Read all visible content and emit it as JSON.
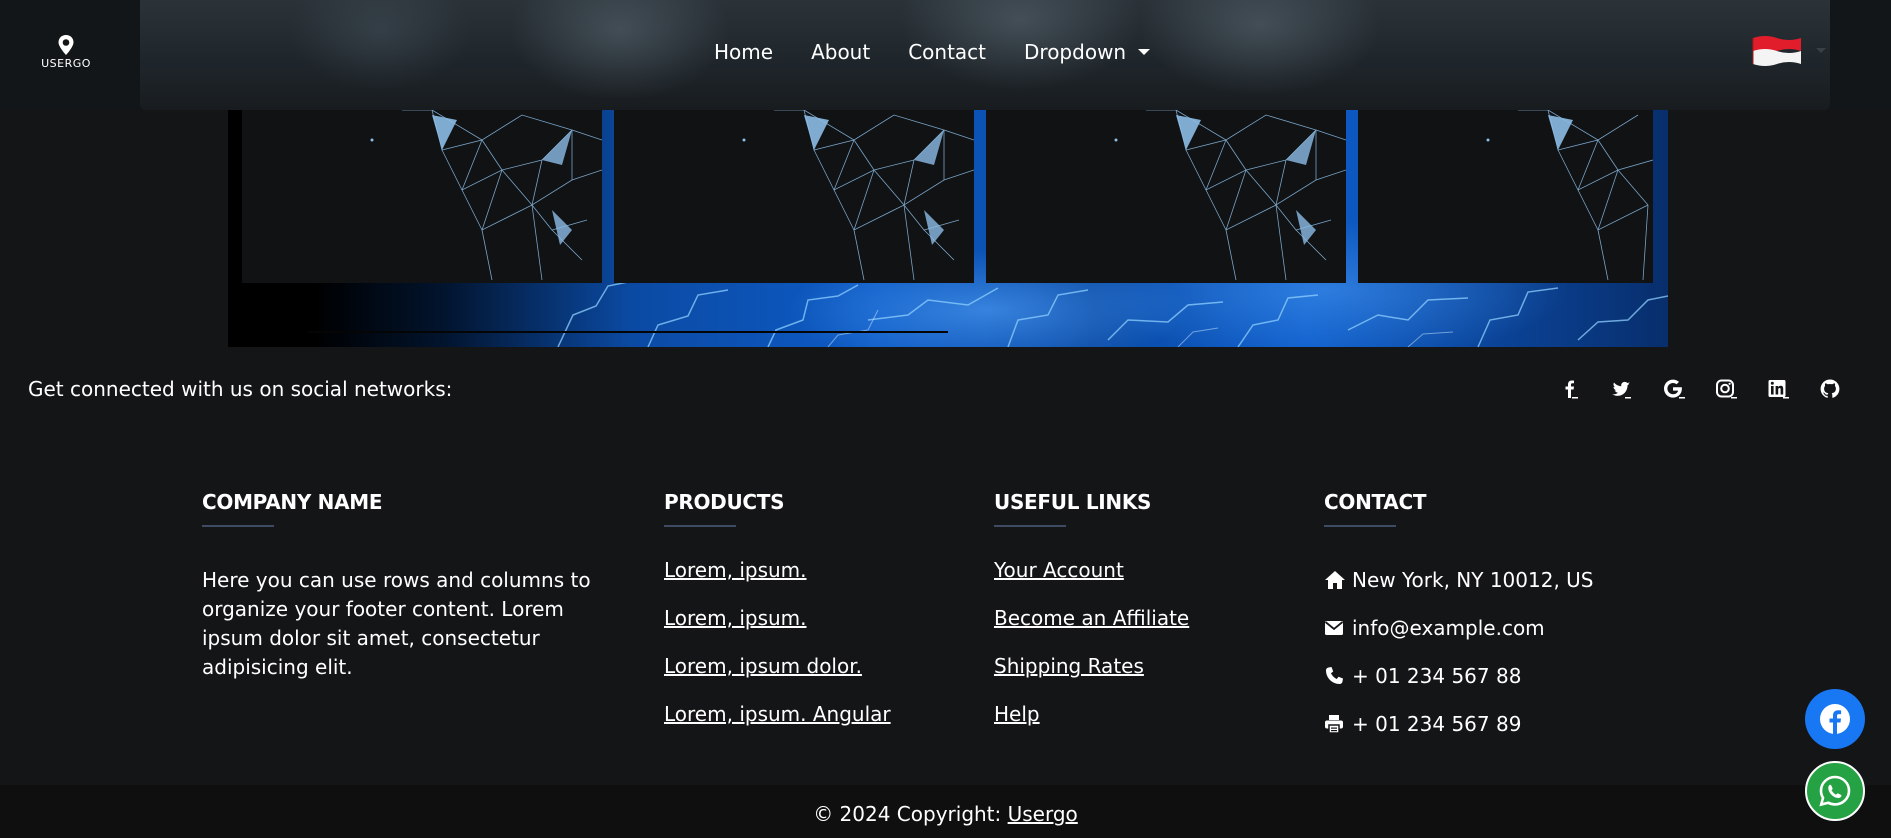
{
  "navbar": {
    "logo_text": "USERGO",
    "links": [
      {
        "label": "Home"
      },
      {
        "label": "About"
      },
      {
        "label": "Contact"
      },
      {
        "label": "Dropdown"
      }
    ],
    "language_flag": "indonesia-flag-icon"
  },
  "carousel": {
    "slides": 4
  },
  "social": {
    "text": "Get connected with us on social networks:",
    "icons": [
      "facebook-icon",
      "twitter-icon",
      "google-icon",
      "instagram-icon",
      "linkedin-icon",
      "github-icon"
    ]
  },
  "footer": {
    "company": {
      "title": "COMPANY NAME",
      "text": "Here you can use rows and columns to organize your footer content. Lorem ipsum dolor sit amet, consectetur adipisicing elit."
    },
    "products": {
      "title": "PRODUCTS",
      "items": [
        "Lorem, ipsum.",
        "Lorem, ipsum.",
        "Lorem, ipsum dolor.",
        "Lorem, ipsum. Angular"
      ]
    },
    "useful_links": {
      "title": "USEFUL LINKS",
      "items": [
        "Your Account",
        "Become an Affiliate",
        "Shipping Rates",
        "Help"
      ]
    },
    "contact": {
      "title": "CONTACT",
      "address": "New York, NY 10012, US",
      "email": "info@example.com",
      "phone": "+ 01 234 567 88",
      "fax": "+ 01 234 567 89"
    }
  },
  "copyright": {
    "prefix": "© 2024 Copyright:",
    "link": "Usergo"
  },
  "floating": {
    "facebook_color": "#1877f2",
    "whatsapp_color": "#25a243"
  }
}
